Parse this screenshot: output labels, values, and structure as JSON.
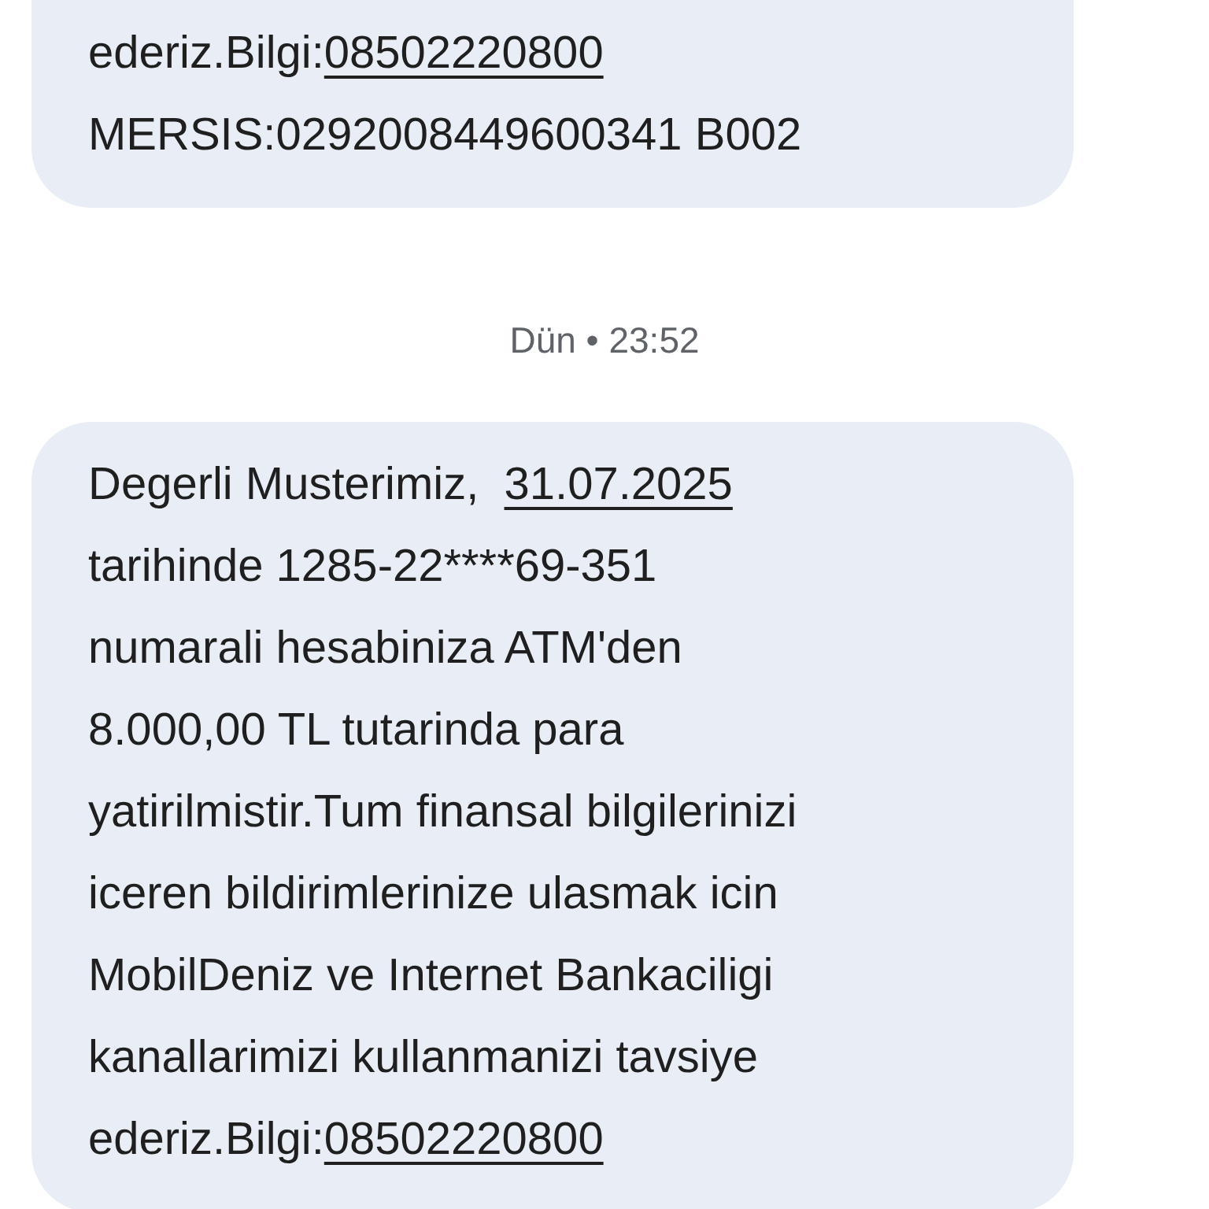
{
  "messages": [
    {
      "kind": "bubble",
      "lines": [
        [
          {
            "text": "ederiz.Bilgi:"
          },
          {
            "text": "08502220800",
            "link": true
          }
        ],
        [
          {
            "text": "MERSIS:0292008449600341 B002"
          }
        ]
      ]
    },
    {
      "kind": "timestamp",
      "text": "Dün • 23:52"
    },
    {
      "kind": "bubble",
      "lines": [
        [
          {
            "text": "Degerli Musterimiz,  "
          },
          {
            "text": "31.07.2025",
            "link": true
          }
        ],
        [
          {
            "text": "tarihinde 1285-22****69-351"
          }
        ],
        [
          {
            "text": "numarali hesabiniza ATM'den"
          }
        ],
        [
          {
            "text": "8.000,00 TL tutarinda para"
          }
        ],
        [
          {
            "text": "yatirilmistir.Tum finansal bilgilerinizi"
          }
        ],
        [
          {
            "text": "iceren bildirimlerinize ulasmak icin"
          }
        ],
        [
          {
            "text": "MobilDeniz ve Internet Bankaciligi"
          }
        ],
        [
          {
            "text": "kanallarimizi kullanmanizi tavsiye"
          }
        ],
        [
          {
            "text": "ederiz.Bilgi:"
          },
          {
            "text": "08502220800",
            "link": true
          }
        ]
      ]
    }
  ]
}
